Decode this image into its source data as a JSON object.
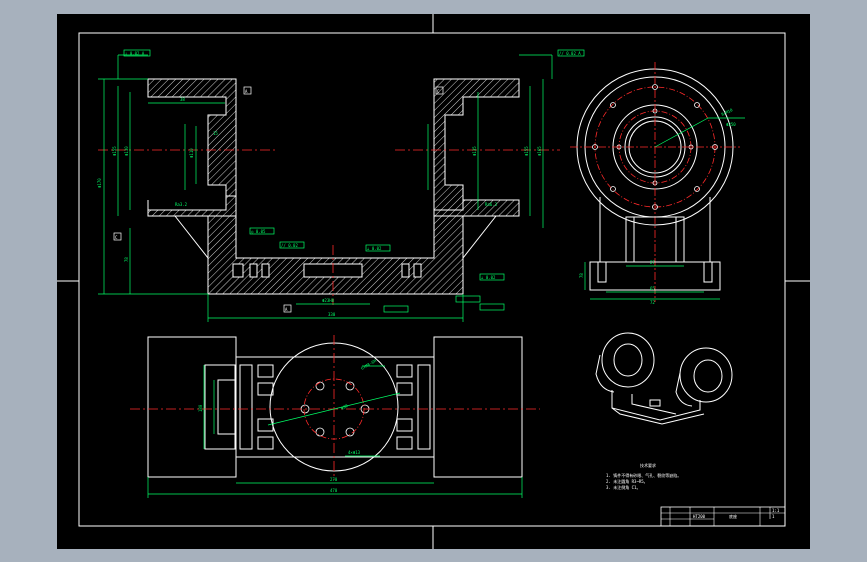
{
  "colors": {
    "background": "#a7b1bd",
    "sheet": "#000000",
    "border": "#ffffff",
    "outline": "#ffffff",
    "centerline": "#ff2a2a",
    "dimension": "#00ff66",
    "hatch": "#ffffff",
    "leader": "#00ff66"
  },
  "front_view": {
    "dims": {
      "left_overall": "Φ170",
      "left_inner": "Φ155",
      "left_bore": "Φ130",
      "left_depth": "38",
      "left_step": "15",
      "left_small": "Φ110",
      "right_inner": "Φ165",
      "right_mid": "Φ155",
      "right_outer": "Φ135",
      "base_height": "78",
      "total_width": "330",
      "bottom_slot": "Φ23H8",
      "ref_a": "A",
      "ref_c": "C"
    },
    "notes": {
      "tol_1": "⊥ 0.02 A",
      "tol_2": "◎ 0.05",
      "tol_3": "// 0.02",
      "tol_4": "// 0.02 A",
      "tol_5": "⊥ 0.02",
      "tol_6": "⊥ 0.02",
      "rough_1": "Ra3.2",
      "rough_2": "Ra6.3"
    }
  },
  "top_view": {
    "dims": {
      "overall_width": "470",
      "inner_width": "270",
      "height_left": "180",
      "circle_note": "4×Φ13",
      "pcd_note": "6×M8-6H",
      "hole_note": "Φ80",
      "ang": "45°"
    }
  },
  "side_view": {
    "dims": {
      "bottom_width": "72",
      "inner_width": "65",
      "height": "78",
      "slot": "27",
      "hole_note": "8×M10",
      "pcd": "Φ250"
    }
  },
  "tech_requirements": {
    "title": "技术要求",
    "lines": [
      "1. 铸件不得有砂眼、气孔、裂纹等缺陷。",
      "2. 未注圆角 R3~R5。",
      "3. 未注倒角 C1。"
    ]
  },
  "title_block": {
    "part_name": "底座",
    "material": "HT200",
    "scale": "1:1",
    "sheet": "1"
  }
}
